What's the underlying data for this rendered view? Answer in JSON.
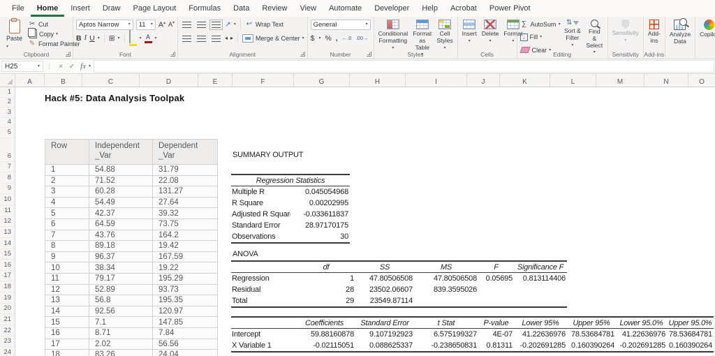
{
  "colors": {
    "accent_green": "#217346",
    "addins_orange": "#d83b01"
  },
  "ribbon": {
    "tabs": [
      {
        "label": "File"
      },
      {
        "label": "Home"
      },
      {
        "label": "Insert"
      },
      {
        "label": "Draw"
      },
      {
        "label": "Page Layout"
      },
      {
        "label": "Formulas"
      },
      {
        "label": "Data"
      },
      {
        "label": "Review"
      },
      {
        "label": "View"
      },
      {
        "label": "Automate"
      },
      {
        "label": "Developer"
      },
      {
        "label": "Help"
      },
      {
        "label": "Acrobat"
      },
      {
        "label": "Power Pivot"
      }
    ],
    "active_tab": "Home",
    "clipboard": {
      "label": "Clipboard",
      "paste": "Paste",
      "cut": "Cut",
      "copy": "Copy",
      "format_painter": "Format Painter"
    },
    "font": {
      "label": "Font",
      "font_name": "Aptos Narrow",
      "font_size": "11",
      "bold": "B",
      "italic": "I",
      "underline": "U",
      "letter_a": "A"
    },
    "alignment": {
      "label": "Alignment",
      "wrap_text": "Wrap Text",
      "merge_center": "Merge & Center"
    },
    "number": {
      "label": "Number",
      "format": "General",
      "currency": "$",
      "percent": "%",
      "comma": ",",
      "increase_decimal": "←.0",
      "decrease_decimal": ".00→"
    },
    "styles": {
      "label": "Styles",
      "conditional_formatting": "Conditional Formatting",
      "format_as_table": "Format as Table",
      "cell_styles": "Cell Styles"
    },
    "cells": {
      "label": "Cells",
      "insert": "Insert",
      "delete": "Delete",
      "format": "Format"
    },
    "editing": {
      "label": "Editing",
      "autosum": "AutoSum",
      "fill": "Fill",
      "clear": "Clear",
      "sort_filter": "Sort & Filter",
      "find_select": "Find & Select"
    },
    "sensitivity": {
      "label": "Sensitivity",
      "button": "Sensitivity"
    },
    "addins": {
      "label": "Add-ins",
      "button": "Add-ins"
    },
    "analyze_data": {
      "button": "Analyze Data"
    },
    "copilot": {
      "button": "Copilot"
    }
  },
  "formula_bar": {
    "name_box": "H25",
    "fx_label": "fx",
    "value": ""
  },
  "grid": {
    "column_headers": [
      "A",
      "B",
      "C",
      "D",
      "E",
      "F",
      "G",
      "H",
      "I",
      "J",
      "K",
      "L",
      "M",
      "N",
      "O"
    ],
    "row_headers": [
      "1",
      "2",
      "3",
      "4",
      "5",
      "6",
      "7",
      "8",
      "9",
      "10",
      "11",
      "12",
      "13",
      "14",
      "15",
      "16",
      "17",
      "18",
      "19",
      "20",
      "21",
      "22",
      "23",
      "24"
    ]
  },
  "sheet": {
    "title": "Hack #5: Data Analysis Toolpak",
    "data_table": {
      "headers": [
        {
          "line1": "Row",
          "line2": ""
        },
        {
          "line1": "Independent",
          "line2": "_Var"
        },
        {
          "line1": "Dependent",
          "line2": "_Var"
        }
      ],
      "rows": [
        [
          "1",
          "54.88",
          "31.79"
        ],
        [
          "2",
          "71.52",
          "22.08"
        ],
        [
          "3",
          "60.28",
          "131.27"
        ],
        [
          "4",
          "54.49",
          "27.64"
        ],
        [
          "5",
          "42.37",
          "39.32"
        ],
        [
          "6",
          "64.59",
          "73.75"
        ],
        [
          "7",
          "43.76",
          "164.2"
        ],
        [
          "8",
          "89.18",
          "19.42"
        ],
        [
          "9",
          "96.37",
          "167.59"
        ],
        [
          "10",
          "38.34",
          "19.22"
        ],
        [
          "11",
          "79.17",
          "195.29"
        ],
        [
          "12",
          "52.89",
          "93.73"
        ],
        [
          "13",
          "56.8",
          "195.35"
        ],
        [
          "14",
          "92.56",
          "120.97"
        ],
        [
          "15",
          "7.1",
          "147.85"
        ],
        [
          "16",
          "8.71",
          "7.84"
        ],
        [
          "17",
          "2.02",
          "56.56"
        ],
        [
          "18",
          "83.26",
          "24.04"
        ]
      ]
    },
    "summary": {
      "title": "SUMMARY OUTPUT",
      "reg_stats": {
        "header": "Regression Statistics",
        "rows": [
          [
            "Multiple R",
            "0.045054968"
          ],
          [
            "R Square",
            "0.00202995"
          ],
          [
            "Adjusted R Square",
            "-0.033611837"
          ],
          [
            "Standard Error",
            "28.97170175"
          ],
          [
            "Observations",
            "30"
          ]
        ]
      },
      "anova": {
        "title": "ANOVA",
        "headers": [
          "",
          "df",
          "SS",
          "MS",
          "F",
          "Significance F"
        ],
        "rows": [
          [
            "Regression",
            "1",
            "47.80506508",
            "47.80506508",
            "0.05695",
            "0.813114406"
          ],
          [
            "Residual",
            "28",
            "23502.06607",
            "839.3595026",
            "",
            ""
          ],
          [
            "Total",
            "29",
            "23549.87114",
            "",
            "",
            ""
          ]
        ]
      },
      "coefficients": {
        "headers": [
          "",
          "Coefficients",
          "Standard Error",
          "t Stat",
          "P-value",
          "Lower 95%",
          "Upper 95%",
          "Lower 95.0%",
          "Upper 95.0%"
        ],
        "rows": [
          [
            "Intercept",
            "59.88160878",
            "9.107192923",
            "6.575199327",
            "4E-07",
            "41.22636976",
            "78.53684781",
            "41.22636976",
            "78.53684781"
          ],
          [
            "X Variable 1",
            "-0.02115051",
            "0.088625337",
            "-0.238650831",
            "0.81311",
            "-0.202691285",
            "0.160390264",
            "-0.202691285",
            "0.160390264"
          ]
        ]
      }
    }
  },
  "icons": {
    "chevron": "▾",
    "cut": "✂",
    "format_painter": "✎",
    "borders": "⊞",
    "caret_up": "▴",
    "caret_down": "▾",
    "orientation": "↗",
    "wrap_text": "↩",
    "autosum": "∑",
    "fill_arrow": "↓",
    "sort_arrows": "⇅",
    "dots": "⋮",
    "cancel": "×",
    "enter": "✓",
    "indent_left": "◂",
    "indent_right": "▸"
  }
}
